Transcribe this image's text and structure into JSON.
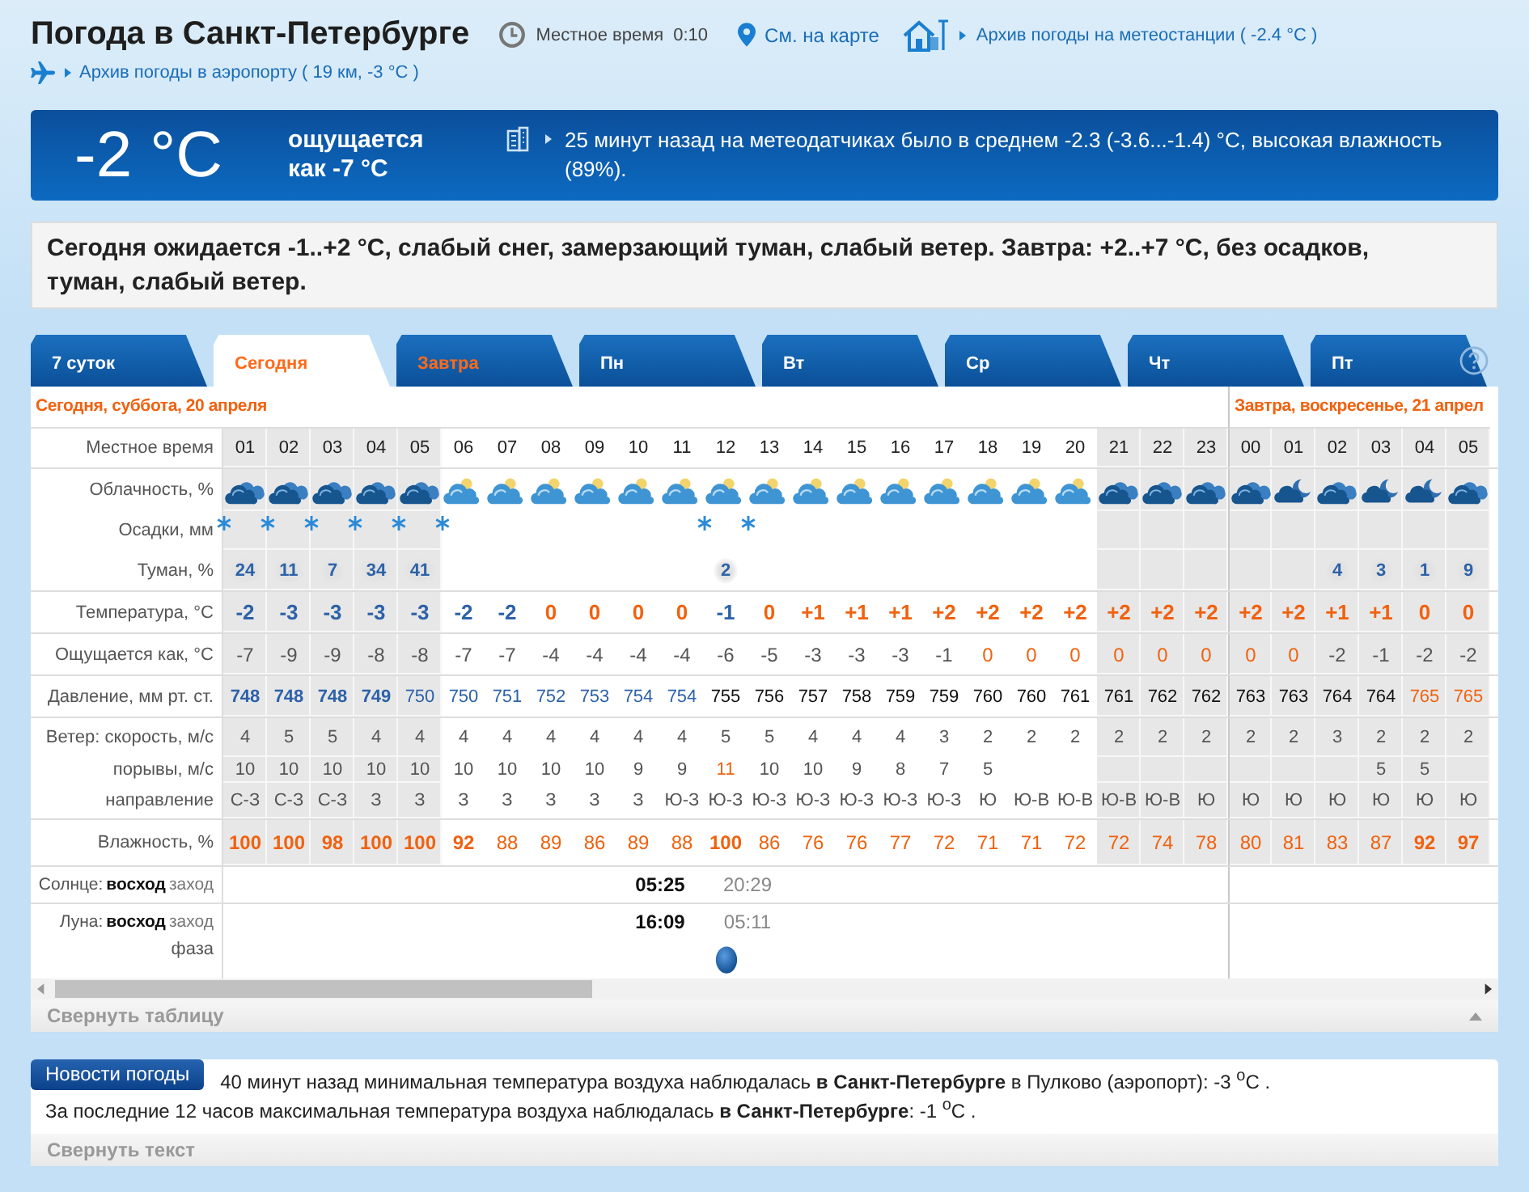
{
  "header": {
    "title": "Погода в Санкт-Петербурге",
    "local_time_label": "Местное время",
    "local_time": "0:10",
    "map_link": "См. на карте",
    "station_archive": "Архив погоды на метеостанции ( -2.4 °C )",
    "airport_archive": "Архив погоды в аэропорту ( 19 км, -3 °C )"
  },
  "current": {
    "temperature": "-2 °C",
    "feels_like": "ощущается как -7 °C",
    "sensors": "25 минут назад на метеодатчиках было в среднем -2.3 (-3.6...-1.4) °C, высокая влажность (89%)."
  },
  "summary": "Сегодня ожидается -1..+2 °C, слабый снег, замерзающий туман, слабый ветер. Завтра: +2..+7 °C, без осадков, туман, слабый ветер.",
  "tabs": [
    {
      "label": "7 суток",
      "selected": false,
      "weekend": false
    },
    {
      "label": "Сегодня",
      "selected": true,
      "weekend": true
    },
    {
      "label": "Завтра",
      "selected": false,
      "weekend": true
    },
    {
      "label": "Пн",
      "selected": false,
      "weekend": false
    },
    {
      "label": "Вт",
      "selected": false,
      "weekend": false
    },
    {
      "label": "Ср",
      "selected": false,
      "weekend": false
    },
    {
      "label": "Чт",
      "selected": false,
      "weekend": false
    },
    {
      "label": "Пт",
      "selected": false,
      "weekend": false
    }
  ],
  "table": {
    "time_label": "Местное время",
    "days": [
      {
        "title": "Сегодня, суббота, 20 апреля",
        "hours": [
          {
            "time": "01",
            "night": true
          },
          {
            "time": "02",
            "night": true
          },
          {
            "time": "03",
            "night": true
          },
          {
            "time": "04",
            "night": true
          },
          {
            "time": "05",
            "night": true
          },
          {
            "time": "06",
            "night": false
          },
          {
            "time": "07",
            "night": false
          },
          {
            "time": "08",
            "night": false
          },
          {
            "time": "09",
            "night": false
          },
          {
            "time": "10",
            "night": false
          },
          {
            "time": "11",
            "night": false
          },
          {
            "time": "12",
            "night": false
          },
          {
            "time": "13",
            "night": false
          },
          {
            "time": "14",
            "night": false
          },
          {
            "time": "15",
            "night": false
          },
          {
            "time": "16",
            "night": false
          },
          {
            "time": "17",
            "night": false
          },
          {
            "time": "18",
            "night": false
          },
          {
            "time": "19",
            "night": false
          },
          {
            "time": "20",
            "night": false
          },
          {
            "time": "21",
            "night": true
          },
          {
            "time": "22",
            "night": true
          },
          {
            "time": "23",
            "night": true
          }
        ]
      },
      {
        "title": "Завтра, воскресенье, 21 апрел",
        "hours": [
          {
            "time": "00",
            "night": true
          },
          {
            "time": "01",
            "night": true
          },
          {
            "time": "02",
            "night": true
          },
          {
            "time": "03",
            "night": true
          },
          {
            "time": "04",
            "night": true
          },
          {
            "time": "05",
            "night": true
          }
        ]
      }
    ],
    "rows": [
      {
        "kind": "cloud",
        "label": "Облачность, %",
        "cells": [
          {
            "kind": "dark"
          },
          {
            "kind": "dark"
          },
          {
            "kind": "dark"
          },
          {
            "kind": "dark"
          },
          {
            "kind": "dark"
          },
          {
            "kind": "light"
          },
          {
            "kind": "light"
          },
          {
            "kind": "light"
          },
          {
            "kind": "light"
          },
          {
            "kind": "light"
          },
          {
            "kind": "light"
          },
          {
            "kind": "light"
          },
          {
            "kind": "light"
          },
          {
            "kind": "light"
          },
          {
            "kind": "light"
          },
          {
            "kind": "light"
          },
          {
            "kind": "light"
          },
          {
            "kind": "light"
          },
          {
            "kind": "light"
          },
          {
            "kind": "light"
          },
          {
            "kind": "dark"
          },
          {
            "kind": "dark"
          },
          {
            "kind": "dark"
          },
          {
            "kind": "dark"
          },
          {
            "kind": "partial"
          },
          {
            "kind": "dark"
          },
          {
            "kind": "partial"
          },
          {
            "kind": "partial"
          },
          {
            "kind": "dark"
          }
        ]
      },
      {
        "kind": "snow",
        "label": "Осадки, мм",
        "cells": [
          {
            "snow": true
          },
          {
            "snow": true
          },
          {
            "snow": true
          },
          {
            "snow": true
          },
          {
            "snow": true
          },
          {
            "snow": true
          },
          null,
          null,
          null,
          null,
          null,
          {
            "snow": true
          },
          {
            "snow": true
          },
          null,
          null,
          null,
          null,
          null,
          null,
          null,
          null,
          null,
          null,
          null,
          null,
          null,
          null,
          null,
          null
        ]
      },
      {
        "kind": "fog",
        "label": "Туман, %",
        "cells": [
          {
            "t": "24",
            "color": "#2d62a8",
            "bold": true
          },
          {
            "t": "11",
            "color": "#2d62a8",
            "bold": true
          },
          {
            "t": "7",
            "color": "#2d62a8",
            "bold": true
          },
          {
            "t": "34",
            "color": "#2d62a8",
            "bold": true
          },
          {
            "t": "41",
            "color": "#2d62a8",
            "bold": true
          },
          null,
          null,
          null,
          null,
          null,
          null,
          {
            "t": "2",
            "color": "#2d62a8",
            "bold": true
          },
          null,
          null,
          null,
          null,
          null,
          null,
          null,
          null,
          null,
          null,
          null,
          null,
          null,
          {
            "t": "4",
            "color": "#2d62a8",
            "bold": true
          },
          {
            "t": "3",
            "color": "#2d62a8",
            "bold": true
          },
          {
            "t": "1",
            "color": "#2d62a8",
            "bold": true
          },
          {
            "t": "9",
            "color": "#2d62a8",
            "bold": true
          }
        ]
      },
      {
        "kind": "temp",
        "label": "Температура, °C",
        "cells": [
          {
            "t": "-2",
            "color": "#2d62a8",
            "bold": true
          },
          {
            "t": "-3",
            "color": "#2d62a8",
            "bold": true
          },
          {
            "t": "-3",
            "color": "#2d62a8",
            "bold": true
          },
          {
            "t": "-3",
            "color": "#2d62a8",
            "bold": true
          },
          {
            "t": "-3",
            "color": "#2d62a8",
            "bold": true
          },
          {
            "t": "-2",
            "color": "#2d62a8",
            "bold": true
          },
          {
            "t": "-2",
            "color": "#2d62a8",
            "bold": true
          },
          {
            "t": "0",
            "color": "#f0620f",
            "bold": true
          },
          {
            "t": "0",
            "color": "#f0620f",
            "bold": true
          },
          {
            "t": "0",
            "color": "#f0620f",
            "bold": true
          },
          {
            "t": "0",
            "color": "#f0620f",
            "bold": true
          },
          {
            "t": "-1",
            "color": "#2d62a8",
            "bold": true
          },
          {
            "t": "0",
            "color": "#f0620f",
            "bold": true
          },
          {
            "t": "+1",
            "color": "#f0620f",
            "bold": true
          },
          {
            "t": "+1",
            "color": "#f0620f",
            "bold": true
          },
          {
            "t": "+1",
            "color": "#f0620f",
            "bold": true
          },
          {
            "t": "+2",
            "color": "#f0620f",
            "bold": true
          },
          {
            "t": "+2",
            "color": "#f0620f",
            "bold": true
          },
          {
            "t": "+2",
            "color": "#f0620f",
            "bold": true
          },
          {
            "t": "+2",
            "color": "#f0620f",
            "bold": true
          },
          {
            "t": "+2",
            "color": "#f0620f",
            "bold": true
          },
          {
            "t": "+2",
            "color": "#f0620f",
            "bold": true
          },
          {
            "t": "+2",
            "color": "#f0620f",
            "bold": true
          },
          {
            "t": "+2",
            "color": "#f0620f",
            "bold": true
          },
          {
            "t": "+2",
            "color": "#f0620f",
            "bold": true
          },
          {
            "t": "+1",
            "color": "#f0620f",
            "bold": true
          },
          {
            "t": "+1",
            "color": "#f0620f",
            "bold": true
          },
          {
            "t": "0",
            "color": "#f0620f",
            "bold": true
          },
          {
            "t": "0",
            "color": "#f0620f",
            "bold": true
          }
        ]
      },
      {
        "kind": "feels",
        "label": "Ощущается как, °C",
        "cells": [
          {
            "t": "-7",
            "color": "#555555",
            "bold": false
          },
          {
            "t": "-9",
            "color": "#555555",
            "bold": false
          },
          {
            "t": "-9",
            "color": "#555555",
            "bold": false
          },
          {
            "t": "-8",
            "color": "#555555",
            "bold": false
          },
          {
            "t": "-8",
            "color": "#555555",
            "bold": false
          },
          {
            "t": "-7",
            "color": "#555555",
            "bold": false
          },
          {
            "t": "-7",
            "color": "#555555",
            "bold": false
          },
          {
            "t": "-4",
            "color": "#555555",
            "bold": false
          },
          {
            "t": "-4",
            "color": "#555555",
            "bold": false
          },
          {
            "t": "-4",
            "color": "#555555",
            "bold": false
          },
          {
            "t": "-4",
            "color": "#555555",
            "bold": false
          },
          {
            "t": "-6",
            "color": "#555555",
            "bold": false
          },
          {
            "t": "-5",
            "color": "#555555",
            "bold": false
          },
          {
            "t": "-3",
            "color": "#555555",
            "bold": false
          },
          {
            "t": "-3",
            "color": "#555555",
            "bold": false
          },
          {
            "t": "-3",
            "color": "#555555",
            "bold": false
          },
          {
            "t": "-1",
            "color": "#555555",
            "bold": false
          },
          {
            "t": "0",
            "color": "#f0620f",
            "bold": false
          },
          {
            "t": "0",
            "color": "#f0620f",
            "bold": false
          },
          {
            "t": "0",
            "color": "#f0620f",
            "bold": false
          },
          {
            "t": "0",
            "color": "#f0620f",
            "bold": false
          },
          {
            "t": "0",
            "color": "#f0620f",
            "bold": false
          },
          {
            "t": "0",
            "color": "#f0620f",
            "bold": false
          },
          {
            "t": "0",
            "color": "#f0620f",
            "bold": false
          },
          {
            "t": "0",
            "color": "#f0620f",
            "bold": false
          },
          {
            "t": "-2",
            "color": "#555555",
            "bold": false
          },
          {
            "t": "-1",
            "color": "#555555",
            "bold": false
          },
          {
            "t": "-2",
            "color": "#555555",
            "bold": false
          },
          {
            "t": "-2",
            "color": "#555555",
            "bold": false
          }
        ]
      },
      {
        "kind": "pressure",
        "label": "Давление, мм рт. ст.",
        "cells": [
          {
            "t": "748",
            "color": "#2d62a8",
            "bold": true
          },
          {
            "t": "748",
            "color": "#2d62a8",
            "bold": true
          },
          {
            "t": "748",
            "color": "#2d62a8",
            "bold": true
          },
          {
            "t": "749",
            "color": "#2d62a8",
            "bold": true
          },
          {
            "t": "750",
            "color": "#2d62a8",
            "bold": false
          },
          {
            "t": "750",
            "color": "#2d62a8",
            "bold": false
          },
          {
            "t": "751",
            "color": "#2d62a8",
            "bold": false
          },
          {
            "t": "752",
            "color": "#2d62a8",
            "bold": false
          },
          {
            "t": "753",
            "color": "#2d62a8",
            "bold": false
          },
          {
            "t": "754",
            "color": "#2d62a8",
            "bold": false
          },
          {
            "t": "754",
            "color": "#2d62a8",
            "bold": false
          },
          {
            "t": "755",
            "color": "#111111",
            "bold": false
          },
          {
            "t": "756",
            "color": "#111111",
            "bold": false
          },
          {
            "t": "757",
            "color": "#111111",
            "bold": false
          },
          {
            "t": "758",
            "color": "#111111",
            "bold": false
          },
          {
            "t": "759",
            "color": "#111111",
            "bold": false
          },
          {
            "t": "759",
            "color": "#111111",
            "bold": false
          },
          {
            "t": "760",
            "color": "#111111",
            "bold": false
          },
          {
            "t": "760",
            "color": "#111111",
            "bold": false
          },
          {
            "t": "761",
            "color": "#111111",
            "bold": false
          },
          {
            "t": "761",
            "color": "#111111",
            "bold": false
          },
          {
            "t": "762",
            "color": "#111111",
            "bold": false
          },
          {
            "t": "762",
            "color": "#111111",
            "bold": false
          },
          {
            "t": "763",
            "color": "#111111",
            "bold": false
          },
          {
            "t": "763",
            "color": "#111111",
            "bold": false
          },
          {
            "t": "764",
            "color": "#111111",
            "bold": false
          },
          {
            "t": "764",
            "color": "#111111",
            "bold": false
          },
          {
            "t": "765",
            "color": "#f0620f",
            "bold": false
          },
          {
            "t": "765",
            "color": "#f0620f",
            "bold": false
          }
        ]
      },
      {
        "kind": "wind",
        "label": "Ветер: скорость, м/с",
        "cells": [
          {
            "t": "4",
            "color": "#555555",
            "bold": false
          },
          {
            "t": "5",
            "color": "#555555",
            "bold": false
          },
          {
            "t": "5",
            "color": "#555555",
            "bold": false
          },
          {
            "t": "4",
            "color": "#555555",
            "bold": false
          },
          {
            "t": "4",
            "color": "#555555",
            "bold": false
          },
          {
            "t": "4",
            "color": "#555555",
            "bold": false
          },
          {
            "t": "4",
            "color": "#555555",
            "bold": false
          },
          {
            "t": "4",
            "color": "#555555",
            "bold": false
          },
          {
            "t": "4",
            "color": "#555555",
            "bold": false
          },
          {
            "t": "4",
            "color": "#555555",
            "bold": false
          },
          {
            "t": "4",
            "color": "#555555",
            "bold": false
          },
          {
            "t": "5",
            "color": "#555555",
            "bold": false
          },
          {
            "t": "5",
            "color": "#555555",
            "bold": false
          },
          {
            "t": "4",
            "color": "#555555",
            "bold": false
          },
          {
            "t": "4",
            "color": "#555555",
            "bold": false
          },
          {
            "t": "4",
            "color": "#555555",
            "bold": false
          },
          {
            "t": "3",
            "color": "#555555",
            "bold": false
          },
          {
            "t": "2",
            "color": "#555555",
            "bold": false
          },
          {
            "t": "2",
            "color": "#555555",
            "bold": false
          },
          {
            "t": "2",
            "color": "#555555",
            "bold": false
          },
          {
            "t": "2",
            "color": "#555555",
            "bold": false
          },
          {
            "t": "2",
            "color": "#555555",
            "bold": false
          },
          {
            "t": "2",
            "color": "#555555",
            "bold": false
          },
          {
            "t": "2",
            "color": "#555555",
            "bold": false
          },
          {
            "t": "2",
            "color": "#555555",
            "bold": false
          },
          {
            "t": "3",
            "color": "#555555",
            "bold": false
          },
          {
            "t": "2",
            "color": "#555555",
            "bold": false
          },
          {
            "t": "2",
            "color": "#555555",
            "bold": false
          },
          {
            "t": "2",
            "color": "#555555",
            "bold": false
          }
        ]
      },
      {
        "kind": "gust",
        "label": "порывы, м/с",
        "cells": [
          {
            "t": "10",
            "color": "#555555",
            "bold": false
          },
          {
            "t": "10",
            "color": "#555555",
            "bold": false
          },
          {
            "t": "10",
            "color": "#555555",
            "bold": false
          },
          {
            "t": "10",
            "color": "#555555",
            "bold": false
          },
          {
            "t": "10",
            "color": "#555555",
            "bold": false
          },
          {
            "t": "10",
            "color": "#555555",
            "bold": false
          },
          {
            "t": "10",
            "color": "#555555",
            "bold": false
          },
          {
            "t": "10",
            "color": "#555555",
            "bold": false
          },
          {
            "t": "10",
            "color": "#555555",
            "bold": false
          },
          {
            "t": "9",
            "color": "#555555",
            "bold": false
          },
          {
            "t": "9",
            "color": "#555555",
            "bold": false
          },
          {
            "t": "11",
            "color": "#f0620f",
            "bold": false
          },
          {
            "t": "10",
            "color": "#555555",
            "bold": false
          },
          {
            "t": "10",
            "color": "#555555",
            "bold": false
          },
          {
            "t": "9",
            "color": "#555555",
            "bold": false
          },
          {
            "t": "8",
            "color": "#555555",
            "bold": false
          },
          {
            "t": "7",
            "color": "#555555",
            "bold": false
          },
          {
            "t": "5",
            "color": "#555555",
            "bold": false
          },
          null,
          null,
          null,
          null,
          null,
          null,
          null,
          null,
          {
            "t": "5",
            "color": "#555555",
            "bold": false
          },
          {
            "t": "5",
            "color": "#555555",
            "bold": false
          },
          null
        ]
      },
      {
        "kind": "direction",
        "label": "направление",
        "cells": [
          {
            "t": "С-З",
            "color": "#555555",
            "bold": false
          },
          {
            "t": "С-З",
            "color": "#555555",
            "bold": false
          },
          {
            "t": "С-З",
            "color": "#555555",
            "bold": false
          },
          {
            "t": "З",
            "color": "#555555",
            "bold": false
          },
          {
            "t": "З",
            "color": "#555555",
            "bold": false
          },
          {
            "t": "З",
            "color": "#555555",
            "bold": false
          },
          {
            "t": "З",
            "color": "#555555",
            "bold": false
          },
          {
            "t": "З",
            "color": "#555555",
            "bold": false
          },
          {
            "t": "З",
            "color": "#555555",
            "bold": false
          },
          {
            "t": "З",
            "color": "#555555",
            "bold": false
          },
          {
            "t": "Ю-З",
            "color": "#555555",
            "bold": false
          },
          {
            "t": "Ю-З",
            "color": "#555555",
            "bold": false
          },
          {
            "t": "Ю-З",
            "color": "#555555",
            "bold": false
          },
          {
            "t": "Ю-З",
            "color": "#555555",
            "bold": false
          },
          {
            "t": "Ю-З",
            "color": "#555555",
            "bold": false
          },
          {
            "t": "Ю-З",
            "color": "#555555",
            "bold": false
          },
          {
            "t": "Ю-З",
            "color": "#555555",
            "bold": false
          },
          {
            "t": "Ю",
            "color": "#555555",
            "bold": false
          },
          {
            "t": "Ю-В",
            "color": "#555555",
            "bold": false
          },
          {
            "t": "Ю-В",
            "color": "#555555",
            "bold": false
          },
          {
            "t": "Ю-В",
            "color": "#555555",
            "bold": false
          },
          {
            "t": "Ю-В",
            "color": "#555555",
            "bold": false
          },
          {
            "t": "Ю",
            "color": "#555555",
            "bold": false
          },
          {
            "t": "Ю",
            "color": "#555555",
            "bold": false
          },
          {
            "t": "Ю",
            "color": "#555555",
            "bold": false
          },
          {
            "t": "Ю",
            "color": "#555555",
            "bold": false
          },
          {
            "t": "Ю",
            "color": "#555555",
            "bold": false
          },
          {
            "t": "Ю",
            "color": "#555555",
            "bold": false
          },
          {
            "t": "Ю",
            "color": "#555555",
            "bold": false
          }
        ]
      },
      {
        "kind": "humidity",
        "label": "Влажность, %",
        "cells": [
          {
            "t": "100",
            "color": "#f0620f",
            "bold": true
          },
          {
            "t": "100",
            "color": "#f0620f",
            "bold": true
          },
          {
            "t": "98",
            "color": "#f0620f",
            "bold": true
          },
          {
            "t": "100",
            "color": "#f0620f",
            "bold": true
          },
          {
            "t": "100",
            "color": "#f0620f",
            "bold": true
          },
          {
            "t": "92",
            "color": "#f0620f",
            "bold": true
          },
          {
            "t": "88",
            "color": "#f0620f",
            "bold": false
          },
          {
            "t": "89",
            "color": "#f0620f",
            "bold": false
          },
          {
            "t": "86",
            "color": "#f0620f",
            "bold": false
          },
          {
            "t": "89",
            "color": "#f0620f",
            "bold": false
          },
          {
            "t": "88",
            "color": "#f0620f",
            "bold": false
          },
          {
            "t": "100",
            "color": "#f0620f",
            "bold": true
          },
          {
            "t": "86",
            "color": "#f0620f",
            "bold": false
          },
          {
            "t": "76",
            "color": "#f0620f",
            "bold": false
          },
          {
            "t": "76",
            "color": "#f0620f",
            "bold": false
          },
          {
            "t": "77",
            "color": "#f0620f",
            "bold": false
          },
          {
            "t": "72",
            "color": "#f0620f",
            "bold": false
          },
          {
            "t": "71",
            "color": "#f0620f",
            "bold": false
          },
          {
            "t": "71",
            "color": "#f0620f",
            "bold": false
          },
          {
            "t": "72",
            "color": "#f0620f",
            "bold": false
          },
          {
            "t": "72",
            "color": "#f0620f",
            "bold": false
          },
          {
            "t": "74",
            "color": "#f0620f",
            "bold": false
          },
          {
            "t": "78",
            "color": "#f0620f",
            "bold": false
          },
          {
            "t": "80",
            "color": "#f0620f",
            "bold": false
          },
          {
            "t": "81",
            "color": "#f0620f",
            "bold": false
          },
          {
            "t": "83",
            "color": "#f0620f",
            "bold": false
          },
          {
            "t": "87",
            "color": "#f0620f",
            "bold": false
          },
          {
            "t": "92",
            "color": "#f0620f",
            "bold": true
          },
          {
            "t": "97",
            "color": "#f0620f",
            "bold": true
          }
        ]
      }
    ],
    "sun": {
      "label": "Солнце:",
      "rise_label": "восход",
      "set_label": "заход",
      "rise": "05:25",
      "set": "20:29"
    },
    "moon": {
      "label": "Луна:",
      "rise_label": "восход",
      "set_label": "заход",
      "rise": "16:09",
      "set": "05:11",
      "phase_label": "фаза"
    },
    "collapse": "Свернуть таблицу"
  },
  "news": {
    "badge": "Новости погоды",
    "items": [
      "40 минут назад минимальная температура воздуха наблюдалась **в Санкт-Петербурге** в Пулково (аэропорт): -3 $^{o}$C .",
      "За последние 12 часов максимальная температура воздуха наблюдалась **в Санкт-Петербурге**: -1 $^{o}$C ."
    ],
    "collapse": "Свернуть текст"
  }
}
